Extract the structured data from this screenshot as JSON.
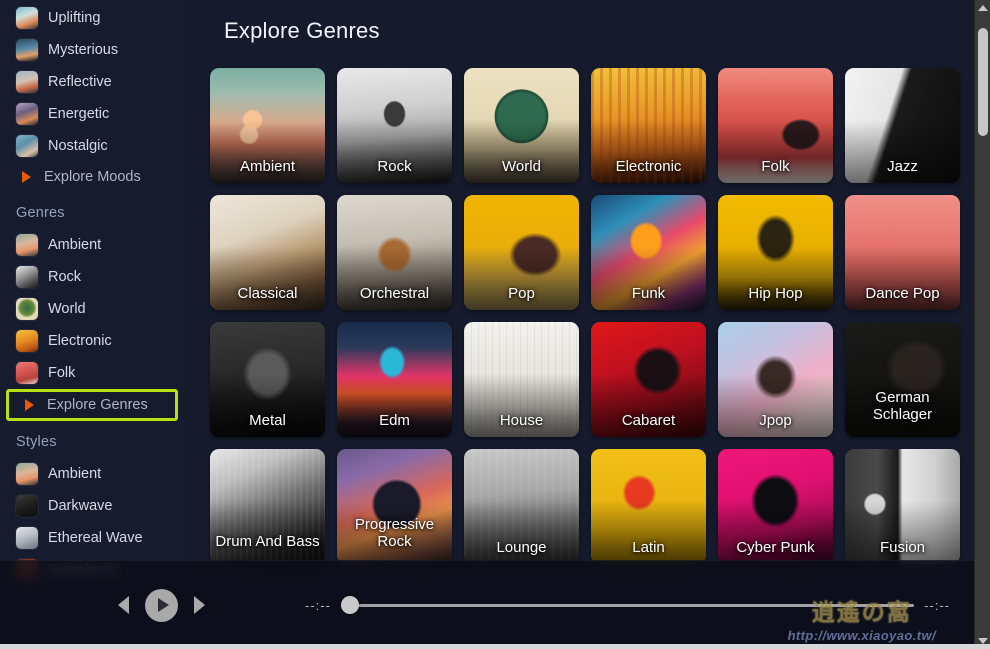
{
  "window": {
    "title": "Explore Genres"
  },
  "sidebar": {
    "moods": [
      {
        "label": "Uplifting",
        "icon": "uplifting-thumb"
      },
      {
        "label": "Mysterious",
        "icon": "mysterious-thumb"
      },
      {
        "label": "Reflective",
        "icon": "reflective-thumb"
      },
      {
        "label": "Energetic",
        "icon": "energetic-thumb"
      },
      {
        "label": "Nostalgic",
        "icon": "nostalgic-thumb"
      }
    ],
    "explore_moods_label": "Explore Moods",
    "genres_heading": "Genres",
    "genres": [
      {
        "label": "Ambient",
        "icon": "ambient-thumb"
      },
      {
        "label": "Rock",
        "icon": "rock-thumb"
      },
      {
        "label": "World",
        "icon": "world-thumb"
      },
      {
        "label": "Electronic",
        "icon": "electronic-thumb"
      },
      {
        "label": "Folk",
        "icon": "folk-thumb"
      }
    ],
    "explore_genres_label": "Explore Genres",
    "styles_heading": "Styles",
    "styles": [
      {
        "label": "Ambient",
        "icon": "ambient-thumb"
      },
      {
        "label": "Darkwave",
        "icon": "darkwave-thumb"
      },
      {
        "label": "Ethereal Wave",
        "icon": "ethereal-wave-thumb"
      },
      {
        "label": "Symphonic",
        "icon": "symphonic-thumb"
      }
    ],
    "highlight_color": "#b6e013",
    "arrow_color": "#e8590c"
  },
  "main": {
    "heading": "Explore Genres",
    "cards": [
      {
        "label": "Ambient",
        "art": "a-ambient",
        "lines": 1
      },
      {
        "label": "Rock",
        "art": "a-rock",
        "lines": 1
      },
      {
        "label": "World",
        "art": "a-world",
        "lines": 1
      },
      {
        "label": "Electronic",
        "art": "a-electronic",
        "lines": 1
      },
      {
        "label": "Folk",
        "art": "a-folk",
        "lines": 1
      },
      {
        "label": "Jazz",
        "art": "a-jazz",
        "lines": 1
      },
      {
        "label": "Classical",
        "art": "a-classical",
        "lines": 1
      },
      {
        "label": "Orchestral",
        "art": "a-orchestral",
        "lines": 1
      },
      {
        "label": "Pop",
        "art": "a-pop",
        "lines": 1
      },
      {
        "label": "Funk",
        "art": "a-funk",
        "lines": 1
      },
      {
        "label": "Hip Hop",
        "art": "a-hiphop",
        "lines": 1
      },
      {
        "label": "Dance Pop",
        "art": "a-dancepop",
        "lines": 1
      },
      {
        "label": "Metal",
        "art": "a-metal",
        "lines": 1
      },
      {
        "label": "Edm",
        "art": "a-edm",
        "lines": 1
      },
      {
        "label": "House",
        "art": "a-house",
        "lines": 1
      },
      {
        "label": "Cabaret",
        "art": "a-cabaret",
        "lines": 1
      },
      {
        "label": "Jpop",
        "art": "a-jpop",
        "lines": 1
      },
      {
        "label": "German Schlager",
        "art": "a-german",
        "lines": 2
      },
      {
        "label": "Drum And Bass",
        "art": "a-dnb",
        "lines": 2
      },
      {
        "label": "Progressive Rock",
        "art": "a-progrock",
        "lines": 2
      },
      {
        "label": "Lounge",
        "art": "a-lounge",
        "lines": 1
      },
      {
        "label": "Latin",
        "art": "a-latin",
        "lines": 1
      },
      {
        "label": "Cyber Punk",
        "art": "a-cyberpunk",
        "lines": 1
      },
      {
        "label": "Fusion",
        "art": "a-fusion",
        "lines": 1
      }
    ]
  },
  "player": {
    "prev_icon": "rewind-icon",
    "play_icon": "play-icon",
    "next_icon": "fast-forward-icon",
    "current_time": "--:--",
    "total_time": "--:--",
    "progress_percent": 0
  },
  "watermark": {
    "logo": "逍遙の窩",
    "url": "http://www.xiaoyao.tw/"
  },
  "scrollbar": {
    "up_icon": "chevron-up-icon",
    "down_icon": "chevron-down-icon"
  }
}
